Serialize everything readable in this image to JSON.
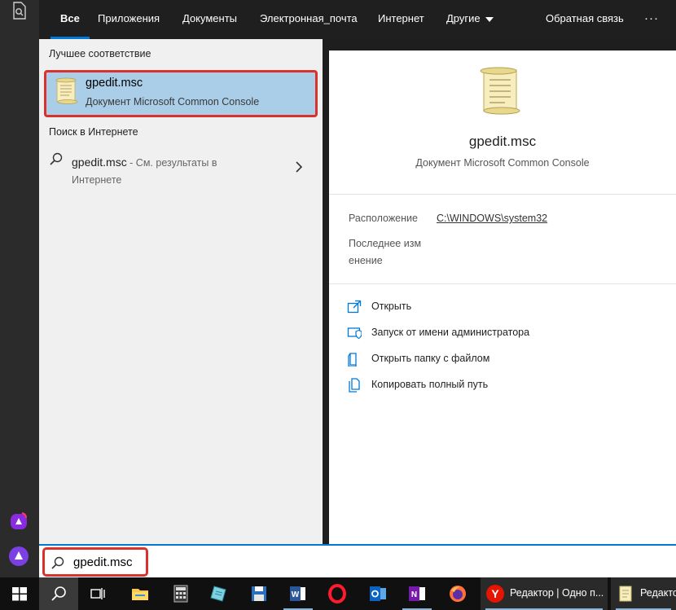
{
  "tabs": [
    {
      "label": "Все",
      "active": true
    },
    {
      "label": "Приложения"
    },
    {
      "label": "Документы"
    },
    {
      "label": "Электронная_почта"
    },
    {
      "label": "Интернет"
    },
    {
      "label": "Другие"
    }
  ],
  "topbar": {
    "feedback_label": "Обратная связь",
    "more_label": "···"
  },
  "results": {
    "best_match_heading": "Лучшее соответствие",
    "best_match": {
      "title": "gpedit.msc",
      "subtitle": "Документ Microsoft Common Console",
      "icon": "scroll-document-icon"
    },
    "web_heading": "Поиск в Интернете",
    "web_item": {
      "title": "gpedit.msc",
      "suffix": " - См. результаты в",
      "suffix_line2": "Интернете"
    }
  },
  "details": {
    "title": "gpedit.msc",
    "subtitle": "Документ Microsoft Common Console",
    "location_label": "Расположение",
    "location_value": "C:\\WINDOWS\\system32",
    "modified_label_line1": "Последнее изм",
    "modified_label_line2": "енение",
    "actions": [
      {
        "label": "Открыть",
        "icon": "open-icon"
      },
      {
        "label": "Запуск от имени администратора",
        "icon": "shield-icon"
      },
      {
        "label": "Открыть папку с файлом",
        "icon": "folder-icon"
      },
      {
        "label": "Копировать полный путь",
        "icon": "copy-icon"
      }
    ]
  },
  "search": {
    "value": "gpedit.msc"
  },
  "taskbar": {
    "items": [
      {
        "name": "start-button",
        "icon": "windows-logo-icon"
      },
      {
        "name": "search-button",
        "icon": "search-icon"
      },
      {
        "name": "task-view-button",
        "icon": "task-view-icon"
      },
      {
        "name": "file-explorer",
        "icon": "folder-icon"
      },
      {
        "name": "calculator",
        "icon": "calculator-icon"
      },
      {
        "name": "notes-app",
        "icon": "notes-icon"
      },
      {
        "name": "floppy-app",
        "icon": "floppy-icon"
      },
      {
        "name": "word",
        "icon": "word-icon"
      },
      {
        "name": "opera",
        "icon": "opera-icon"
      },
      {
        "name": "outlook",
        "icon": "outlook-icon"
      },
      {
        "name": "onenote",
        "icon": "onenote-icon"
      },
      {
        "name": "firefox",
        "icon": "firefox-icon"
      }
    ],
    "window_yandex_label": "Редактор | Одно п...",
    "window_gpedit_label": "Редакто"
  },
  "colors": {
    "accent": "#0078d7",
    "highlight_border": "#d9322c",
    "selected_bg": "#aacde8"
  }
}
